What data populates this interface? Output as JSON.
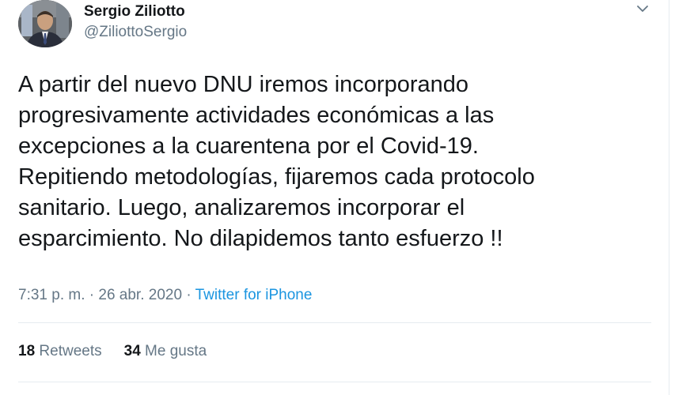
{
  "author": {
    "name": "Sergio Ziliotto",
    "handle": "@ZiliottoSergio"
  },
  "tweet": {
    "text": "A partir del nuevo DNU iremos incorporando\nprogresivamente actividades económicas a las\nexcepciones a la cuarentena por el Covid-19.\nRepitiendo metodologías, fijaremos cada protocolo\nsanitario. Luego, analizaremos incorporar el\nesparcimiento. No dilapidemos tanto esfuerzo !!"
  },
  "meta": {
    "time": "7:31 p. m.",
    "separator": " · ",
    "date": "26 abr. 2020",
    "source": "Twitter for iPhone"
  },
  "stats": {
    "retweets_count": "18",
    "retweets_label": "Retweets",
    "likes_count": "34",
    "likes_label": "Me gusta"
  },
  "icons": {
    "menu": "chevron-down-icon"
  },
  "colors": {
    "text": "#14171a",
    "secondary": "#657786",
    "link": "#1b95e0",
    "divider": "#e6ecf0"
  }
}
